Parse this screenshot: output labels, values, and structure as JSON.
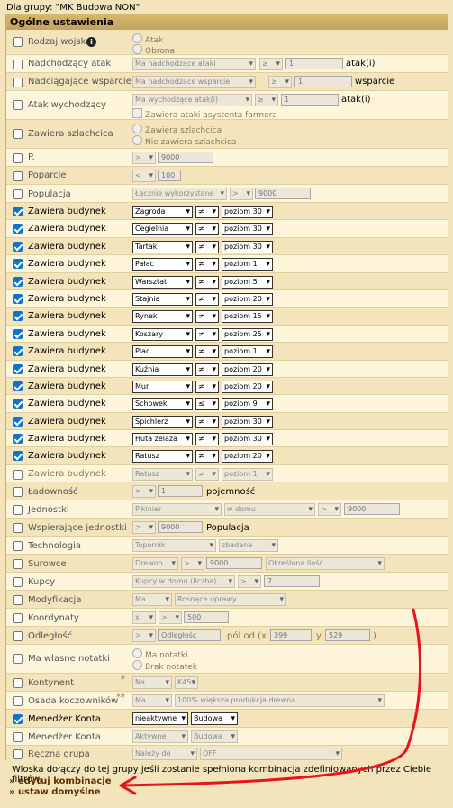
{
  "group_title": "Dla grupy: \"MK Budowa NON\"",
  "panel_title": "Ogólne ustawienia",
  "rows": {
    "army": {
      "label": "Rodzaj wojsk",
      "opt1": "Atak",
      "opt2": "Obrona"
    },
    "incoming": {
      "label": "Nadchodzący atak",
      "select1": "Ma nadchodzące ataki",
      "op": "≥",
      "value": "1",
      "suffix": "atak(i)"
    },
    "support": {
      "label": "Nadciągające wsparcie",
      "select1": "Ma nadchodzące wsparcie",
      "op": "≥",
      "value": "1",
      "suffix": "wsparcie"
    },
    "outgoing": {
      "label": "Atak wychodzący",
      "select1": "Ma wychodzące atak(i)",
      "op": "≥",
      "value": "1",
      "suffix": "atak(i)",
      "check": "Zawiera ataki asystenta farmera"
    },
    "noble": {
      "label": "Zawiera szlachcica",
      "opt1": "Zawiera szlachcica",
      "opt2": "Nie zawiera szlachcica"
    },
    "points": {
      "label": "P.",
      "op": ">",
      "value": "9000"
    },
    "loyalty": {
      "label": "Poparcie",
      "op": "<",
      "value": "100"
    },
    "population": {
      "label": "Populacja",
      "select1": "Łącznie wykorzystane",
      "op": ">",
      "value": "9000"
    },
    "buildings": [
      {
        "label": "Zawiera budynek",
        "building": "Zagroda",
        "op": "≠",
        "level": "poziom 30"
      },
      {
        "label": "Zawiera budynek",
        "building": "Cegielnia",
        "op": "≠",
        "level": "poziom 30"
      },
      {
        "label": "Zawiera budynek",
        "building": "Tartak",
        "op": "≠",
        "level": "poziom 30"
      },
      {
        "label": "Zawiera budynek",
        "building": "Pałac",
        "op": "≠",
        "level": "poziom 1"
      },
      {
        "label": "Zawiera budynek",
        "building": "Warsztat",
        "op": "≠",
        "level": "poziom 5"
      },
      {
        "label": "Zawiera budynek",
        "building": "Stajnia",
        "op": "≠",
        "level": "poziom 20"
      },
      {
        "label": "Zawiera budynek",
        "building": "Rynek",
        "op": "≠",
        "level": "poziom 15"
      },
      {
        "label": "Zawiera budynek",
        "building": "Koszary",
        "op": "≠",
        "level": "poziom 25"
      },
      {
        "label": "Zawiera budynek",
        "building": "Plac",
        "op": "≠",
        "level": "poziom 1"
      },
      {
        "label": "Zawiera budynek",
        "building": "Kuźnia",
        "op": "≠",
        "level": "poziom 20"
      },
      {
        "label": "Zawiera budynek",
        "building": "Mur",
        "op": "≠",
        "level": "poziom 20"
      },
      {
        "label": "Zawiera budynek",
        "building": "Schowek",
        "op": "≤",
        "level": "poziom 9"
      },
      {
        "label": "Zawiera budynek",
        "building": "Spichlerz",
        "op": "≠",
        "level": "poziom 30"
      },
      {
        "label": "Zawiera budynek",
        "building": "Huta żelaza",
        "op": "≠",
        "level": "poziom 30"
      },
      {
        "label": "Zawiera budynek",
        "building": "Ratusz",
        "op": "≠",
        "level": "poziom 20"
      }
    ],
    "building_off": {
      "label": "Zawiera budynek",
      "building": "Ratusz",
      "op": "≠",
      "level": "poziom 1"
    },
    "capacity": {
      "label": "Ładowność",
      "op": ">",
      "value": "1",
      "suffix": "pojemność"
    },
    "units": {
      "label": "Jednostki",
      "unit": "Pikinier",
      "where": "w domu",
      "op": ">",
      "value": "9000"
    },
    "support_units": {
      "label": "Wspierające jednostki",
      "op": ">",
      "value": "9000",
      "suffix": "Populacja"
    },
    "tech": {
      "label": "Technologia",
      "unit": "Topornik",
      "state": "zbadane"
    },
    "resources": {
      "label": "Surowce",
      "res": "Drewno",
      "op": ">",
      "value": "9000",
      "mode": "Określona ilość"
    },
    "merchants": {
      "label": "Kupcy",
      "type": "Kupcy w domu (liczba)",
      "op": ">",
      "value": "7"
    },
    "modifier": {
      "label": "Modyfikacja",
      "has": "Ma",
      "mod": "Rosnące uprawy"
    },
    "coords": {
      "label": "Koordynaty",
      "axis": "x",
      "op": ">",
      "value": "500"
    },
    "distance": {
      "label": "Odległość",
      "op": ">",
      "value": "Odległość",
      "text1": "pól od (x",
      "x": "399",
      "text2": "y",
      "y": "529",
      "text3": ")"
    },
    "notes": {
      "label": "Ma własne notatki",
      "opt1": "Ma notatki",
      "opt2": "Brak notatek"
    },
    "continent": {
      "label": "Kontynent",
      "star": "*",
      "has": "Na",
      "k": "K45"
    },
    "nomad": {
      "label": "Osada koczowników",
      "star": "**",
      "has": "Ma",
      "bonus": "100% większa produkcja drewna"
    },
    "manager1": {
      "label": "Menedżer Konta",
      "state": "nieaktywne",
      "type": "Budowa"
    },
    "manager2": {
      "label": "Menedżer Konta",
      "state": "Aktywne",
      "type": "Budowa"
    },
    "manual": {
      "label": "Ręczna grupa",
      "rel": "Należy do",
      "group": "OFF"
    }
  },
  "footer": {
    "text": "Wioska dołączy do tej grupy jeśli zostanie spełniona kombinacja zdefiniowanych przez Ciebie filtrów.",
    "link1": "» edytuj kombinacje",
    "link2": "» ustaw domyślne"
  },
  "colors": {
    "background": "#f4e4bc",
    "header": "#c1a264",
    "arrow": "#e8141c",
    "check": "#0a74d1"
  }
}
